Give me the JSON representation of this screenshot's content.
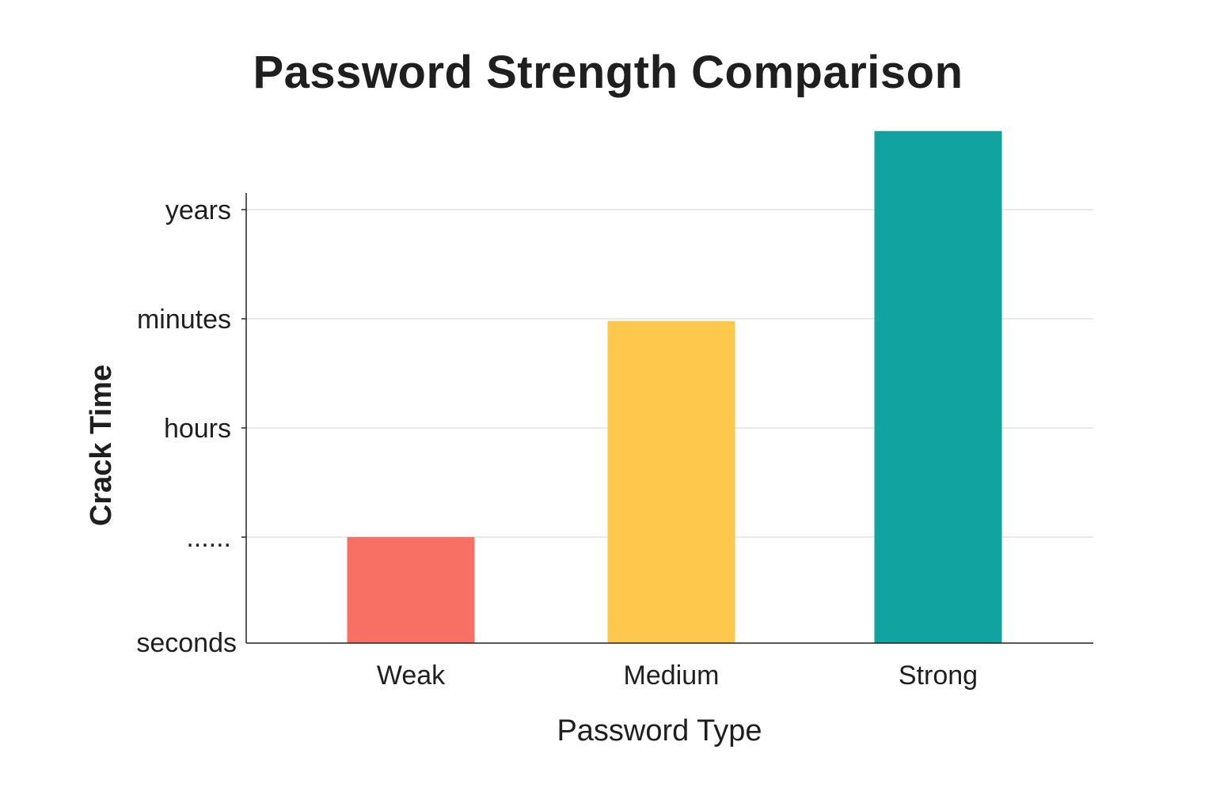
{
  "chart_data": {
    "type": "bar",
    "title": "Password Strength Comparison",
    "xlabel": "Password Type",
    "ylabel": "Crack Time",
    "categories": [
      "Weak",
      "Medium",
      "Strong"
    ],
    "values": [
      1,
      2.98,
      4.72
    ],
    "y_tick_labels": [
      "seconds",
      "......",
      "hours",
      "minutes",
      "years"
    ],
    "y_tick_values": [
      0,
      1,
      2,
      3,
      4
    ],
    "ylim": [
      0,
      4
    ],
    "bar_colors": [
      "#f87064",
      "#fdc84b",
      "#10a39f"
    ],
    "grid": true,
    "legend": "none"
  }
}
